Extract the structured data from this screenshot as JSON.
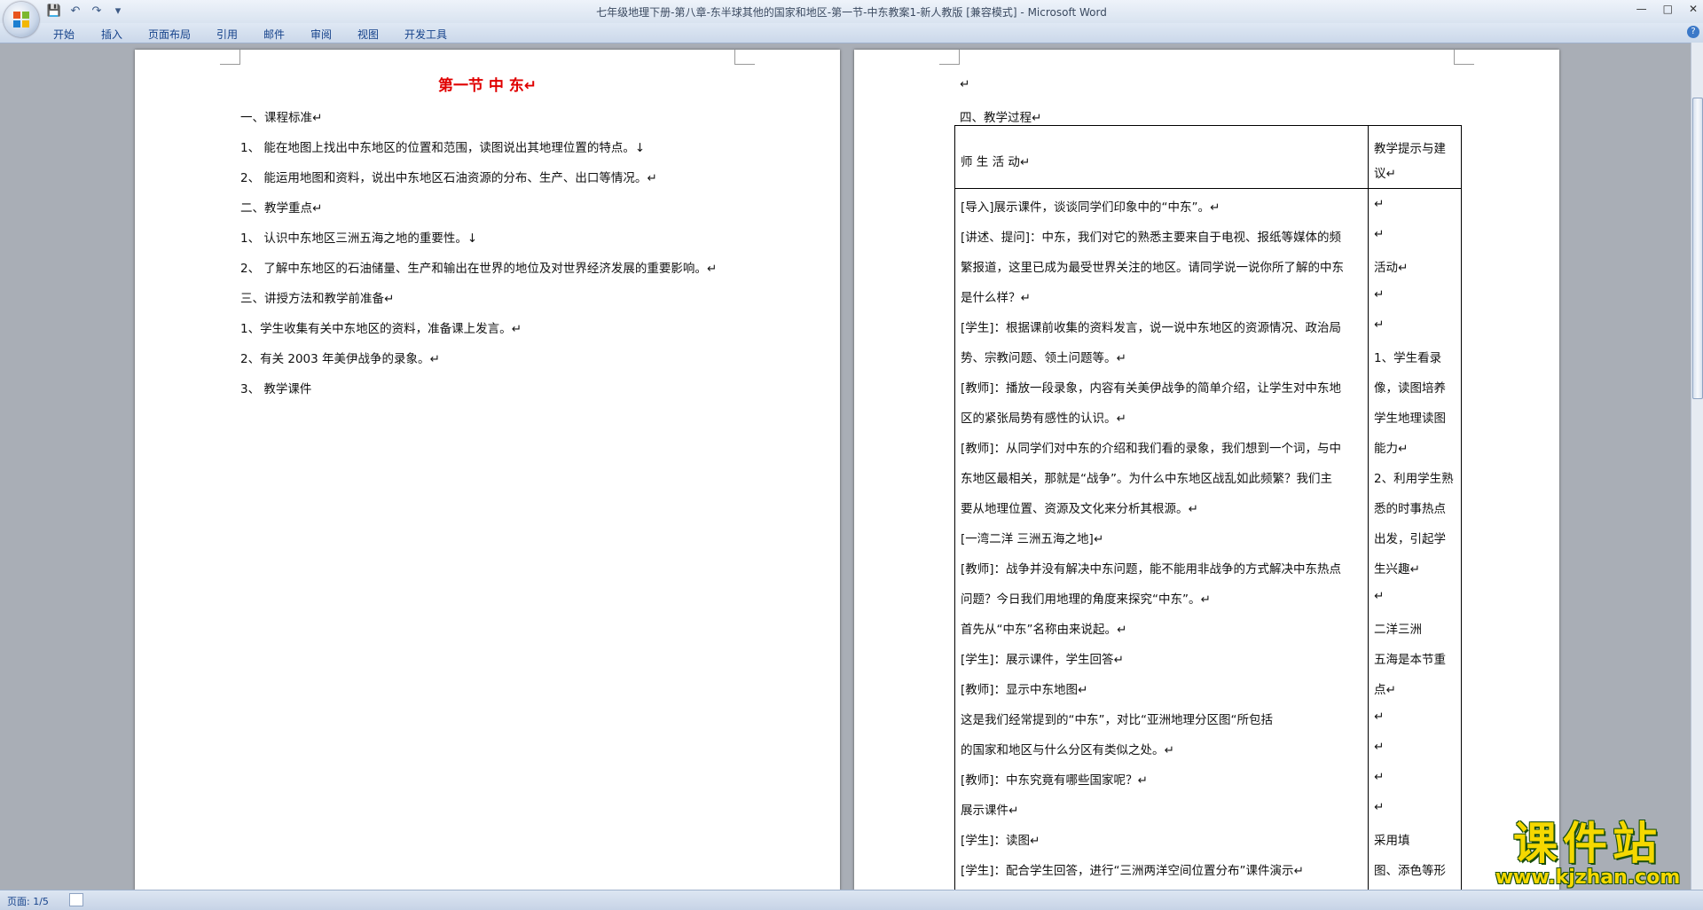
{
  "window": {
    "title": "七年级地理下册-第八章-东半球其他的国家和地区-第一节-中东教案1-新人教版 [兼容模式] - Microsoft Word",
    "qat": [
      "💾",
      "↶",
      "↷",
      "▾"
    ],
    "controls": [
      "—",
      "□",
      "✕"
    ]
  },
  "ribbon": {
    "tabs": [
      "开始",
      "插入",
      "页面布局",
      "引用",
      "邮件",
      "审阅",
      "视图",
      "开发工具"
    ],
    "help": "?"
  },
  "page1": {
    "title": "第一节  中  东↵",
    "lines": [
      "一、课程标准↵",
      "1、 能在地图上找出中东地区的位置和范围，读图说出其地理位置的特点。↓",
      "2、 能运用地图和资料，说出中东地区石油资源的分布、生产、出口等情况。↵",
      "二、教学重点↵",
      "1、 认识中东地区三洲五海之地的重要性。↓",
      "2、 了解中东地区的石油储量、生产和输出在世界的地位及对世界经济发展的重要影响。↵",
      "三、讲授方法和教学前准备↵",
      "1、学生收集有关中东地区的资料，准备课上发言。↵",
      "2、有关 2003 年美伊战争的录象。↵",
      "3、 教学课件"
    ]
  },
  "page2": {
    "top_mark": "↵",
    "heading": "四、教学过程↵",
    "table": {
      "header_left": "师  生  活  动↵",
      "header_right": [
        "教学提示与建",
        "议↵"
      ],
      "left": [
        "[导入]展示课件，谈谈同学们印象中的“中东”。↵",
        "[讲述、提问]：中东，我们对它的熟悉主要来自于电视、报纸等媒体的频",
        "繁报道，这里已成为最受世界关注的地区。请同学说一说你所了解的中东",
        "是什么样？↵",
        "[学生]：根据课前收集的资料发言，说一说中东地区的资源情况、政治局",
        "势、宗教问题、领土问题等。↵",
        "[教师]：播放一段录象，内容有关美伊战争的简单介绍，让学生对中东地",
        "区的紧张局势有感性的认识。↵",
        "[教师]：从同学们对中东的介绍和我们看的录象，我们想到一个词，与中",
        "东地区最相关，那就是“战争”。为什么中东地区战乱如此频繁？我们主",
        "要从地理位置、资源及文化来分析其根源。↵",
        "[一湾二洋 三洲五海之地]↵",
        "[教师]：战争并没有解决中东问题，能不能用非战争的方式解决中东热点",
        "问题？今日我们用地理的角度来探究“中东”。↵",
        "      首先从“中东”名称由来说起。↵",
        "[学生]：展示课件，学生回答↵",
        "[教师]：显示中东地图↵",
        "            这是我们经常提到的“中东”，对比“亚洲地理分区图“所包括",
        "的国家和地区与什么分区有类似之处。↵",
        "[教师]：中东究竟有哪些国家呢？↵",
        "展示课件↵",
        "[学生]：读图↵",
        "[学生]：配合学生回答，进行“三洲两洋空间位置分布”课件演示↵"
      ],
      "right": [
        "↵",
        "↵",
        "活动↵",
        "↵",
        "    ↵",
        "1、学生看录",
        "像，读图培养",
        "学生地理读图",
        "能力↵",
        "2、利用学生熟",
        "悉的时事热点",
        "出发，引起学",
        "生兴趣↵",
        "    ↵",
        "  二洋三洲",
        "五海是本节重",
        "点↵",
        "    ↵",
        "    ↵",
        "    ↵",
        "    ↵",
        "   采用填",
        "图、添色等形"
      ]
    }
  },
  "status": {
    "page": "页面: 1/5"
  },
  "watermark": {
    "main": "课件站",
    "sub": "www.kjzhan.com"
  }
}
